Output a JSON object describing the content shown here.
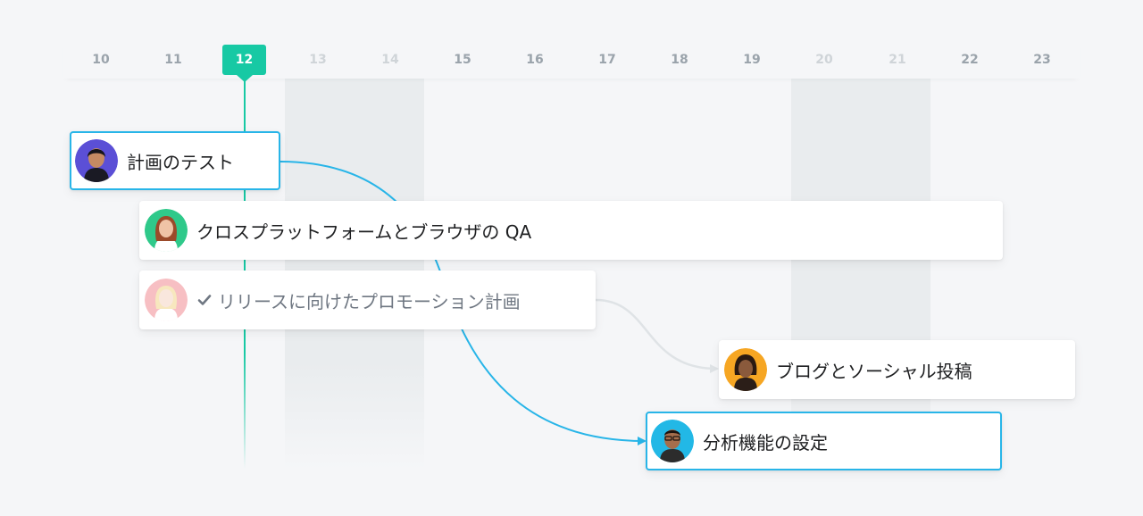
{
  "timeline": {
    "days": [
      {
        "label": "10",
        "weekend": false
      },
      {
        "label": "11",
        "weekend": false
      },
      {
        "label": "12",
        "weekend": false,
        "today": true
      },
      {
        "label": "13",
        "weekend": true
      },
      {
        "label": "14",
        "weekend": true
      },
      {
        "label": "15",
        "weekend": false
      },
      {
        "label": "16",
        "weekend": false
      },
      {
        "label": "17",
        "weekend": false
      },
      {
        "label": "18",
        "weekend": false
      },
      {
        "label": "19",
        "weekend": false
      },
      {
        "label": "20",
        "weekend": true
      },
      {
        "label": "21",
        "weekend": true
      },
      {
        "label": "22",
        "weekend": false
      },
      {
        "label": "23",
        "weekend": false
      }
    ],
    "today_label": "12"
  },
  "tasks": [
    {
      "name": "計画のテスト",
      "avatar": "avatar-person-purple-bg",
      "selected": true,
      "done": false
    },
    {
      "name": "クロスプラットフォームとブラウザの QA",
      "avatar": "avatar-person-green-bg",
      "selected": false,
      "done": false
    },
    {
      "name": "リリースに向けたプロモーション計画",
      "avatar": "avatar-person-pink-bg",
      "selected": false,
      "done": true
    },
    {
      "name": "ブログとソーシャル投稿",
      "avatar": "avatar-person-orange-bg",
      "selected": false,
      "done": false
    },
    {
      "name": "分析機能の設定",
      "avatar": "avatar-person-blue-bg",
      "selected": true,
      "done": false
    }
  ],
  "colors": {
    "today_accent": "#17c9a4",
    "selected_border": "#28b5e8",
    "dependency_active": "#28b5e8",
    "dependency_inactive": "#dfe3e6",
    "weekend_column": "#e9ecee"
  },
  "icons": {
    "completed": "check-icon"
  }
}
